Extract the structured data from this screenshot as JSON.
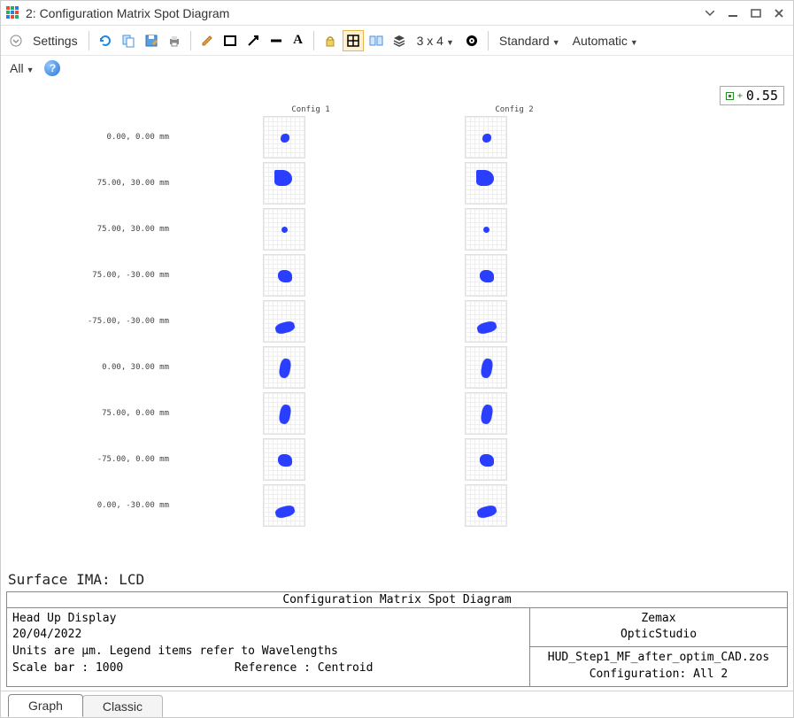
{
  "window": {
    "title": "2: Configuration Matrix Spot Diagram"
  },
  "toolbar": {
    "settings_label": "Settings",
    "grid_label": "3 x 4",
    "mode_label": "Standard",
    "auto_label": "Automatic"
  },
  "subbar": {
    "all_label": "All"
  },
  "zoom": {
    "value": "0.55"
  },
  "matrix": {
    "col_headers": [
      "Config 1",
      "Config 2"
    ],
    "rows": [
      {
        "label": "0.00, 0.00 mm",
        "shape": "s-small"
      },
      {
        "label": "75.00, 30.00 mm",
        "shape": "s-comet"
      },
      {
        "label": "75.00, 30.00 mm",
        "shape": "s-dot"
      },
      {
        "label": "75.00, -30.00 mm",
        "shape": "s-med"
      },
      {
        "label": "-75.00, -30.00 mm",
        "shape": "s-stretch"
      },
      {
        "label": "0.00, 30.00 mm",
        "shape": "s-tall"
      },
      {
        "label": "75.00, 0.00 mm",
        "shape": "s-tall"
      },
      {
        "label": "-75.00, 0.00 mm",
        "shape": "s-med"
      },
      {
        "label": "0.00, -30.00 mm",
        "shape": "s-stretch"
      }
    ]
  },
  "surface_line": "Surface IMA: LCD",
  "info": {
    "title": "Configuration Matrix Spot Diagram",
    "left_line1": "Head Up Display",
    "left_line2": "20/04/2022",
    "left_line3": "Units are µm. Legend items refer to Wavelengths",
    "left_line4a": "Scale bar  : 1000",
    "left_line4b": "Reference  : Centroid",
    "right_top1": "Zemax",
    "right_top2": "OpticStudio",
    "right_bot1": "HUD_Step1_MF_after_optim_CAD.zos",
    "right_bot2": "Configuration: All 2"
  },
  "tabs": {
    "graph": "Graph",
    "classic": "Classic"
  }
}
